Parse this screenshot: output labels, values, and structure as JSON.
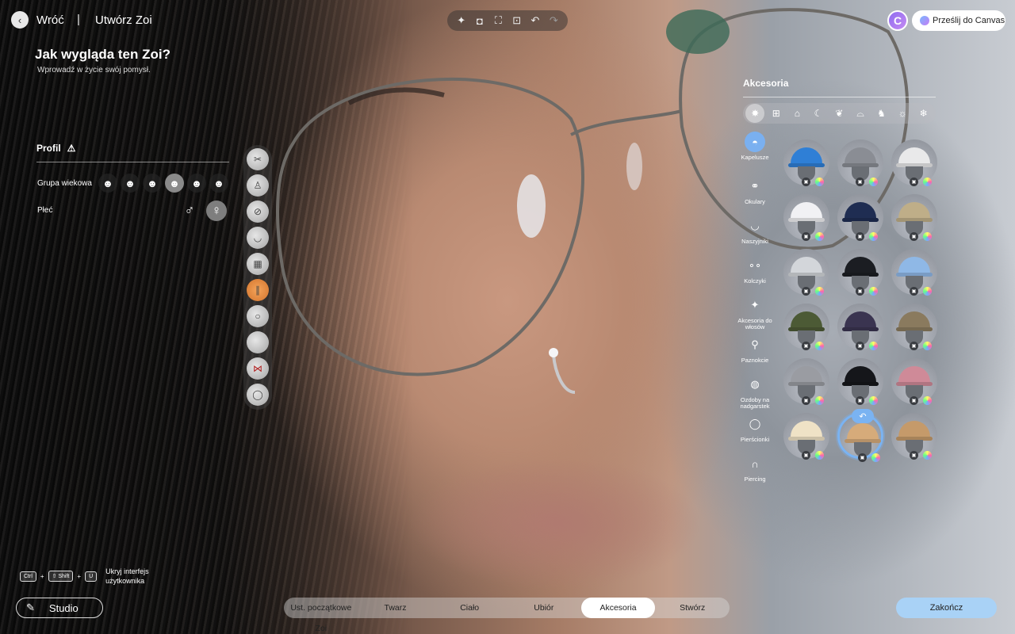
{
  "nav": {
    "back_icon": "chevron-left-icon",
    "back_label": "Wróć",
    "separator": "|",
    "create_label": "Utwórz Zoi"
  },
  "toolbar": {
    "icons": [
      "sparkle-icon",
      "camera-icon",
      "frame-capture-icon",
      "face-focus-icon",
      "undo-icon",
      "redo-icon"
    ]
  },
  "canvas": {
    "avatar_letter": "C",
    "send_label": "Prześlij do Canvas"
  },
  "header": {
    "title": "Jak wygląda ten Zoi?",
    "subtitle": "Wprowadź w życie swój pomysł."
  },
  "profile": {
    "label": "Profil",
    "age_group_label": "Grupa wiekowa",
    "age_groups": [
      "infant-icon",
      "child-icon",
      "teen-icon",
      "young-adult-icon",
      "adult-icon",
      "elder-icon"
    ],
    "selected_age_index": 3,
    "gender_label": "Płeć",
    "genders": [
      "male-icon",
      "female-icon"
    ],
    "selected_gender_index": 1
  },
  "accessories": {
    "title": "Akcesoria",
    "categories": [
      "sparkle-all-icon",
      "gift-icon",
      "graduation-cap-icon",
      "moon-icon",
      "fantasy-icon",
      "shoe-icon",
      "pet-icon",
      "sun-icon",
      "snowflake-icon"
    ],
    "selected_category_index": 0,
    "subcategories": [
      {
        "label": "Kapelusze",
        "icon": "cap-icon"
      },
      {
        "label": "Okulary",
        "icon": "glasses-icon"
      },
      {
        "label": "Naszyjniki",
        "icon": "necklace-icon"
      },
      {
        "label": "Kolczyki",
        "icon": "earrings-icon"
      },
      {
        "label": "Akcesoria do włosów",
        "icon": "hair-clip-icon"
      },
      {
        "label": "Paznokcie",
        "icon": "nail-polish-icon"
      },
      {
        "label": "Ozdoby na nadgarstek",
        "icon": "bracelet-icon"
      },
      {
        "label": "Pierścionki",
        "icon": "ring-icon"
      },
      {
        "label": "Piercing",
        "icon": "piercing-icon"
      }
    ],
    "selected_subcategory_index": 0,
    "items_colors": [
      [
        "#2f7fd6",
        "#8a8d94",
        "#e9e9ea"
      ],
      [
        "#f1f1f4",
        "#1f2d52",
        "#bfae88"
      ],
      [
        "#d3d6da",
        "#1b1d22",
        "#8fb8e6"
      ],
      [
        "#4c5a35",
        "#3a3450",
        "#8a7a5e"
      ],
      [
        "#9a9ca2",
        "#15161a",
        "#cf8a98"
      ],
      [
        "#efe2c6",
        "#d6ab7a",
        "#c59a6a"
      ]
    ],
    "selected_item": [
      5,
      1
    ],
    "reset_icon": "undo-icon"
  },
  "thumbnails": [
    "hair-clip-thumb-icon",
    "figure-thumb-icon",
    "hidden-thumb-icon",
    "necklace-thumb-icon",
    "bracelet-thumb-icon",
    "nails-thumb-icon",
    "ring-thumb-icon",
    "blank-thumb-icon",
    "bow-thumb-icon",
    "earring-thumb-icon"
  ],
  "shortcut": {
    "keys": [
      "Ctrl",
      "⇧ Shift",
      "U"
    ],
    "plus": "+",
    "text": "Ukryj interfejs użytkownika"
  },
  "studio_label": "Studio",
  "tabs": [
    "Ust. początkowe Zoi",
    "Twarz",
    "Ciało",
    "Ubiór",
    "Akcesoria",
    "Stwórz"
  ],
  "selected_tab_index": 4,
  "finish_label": "Zakończ"
}
